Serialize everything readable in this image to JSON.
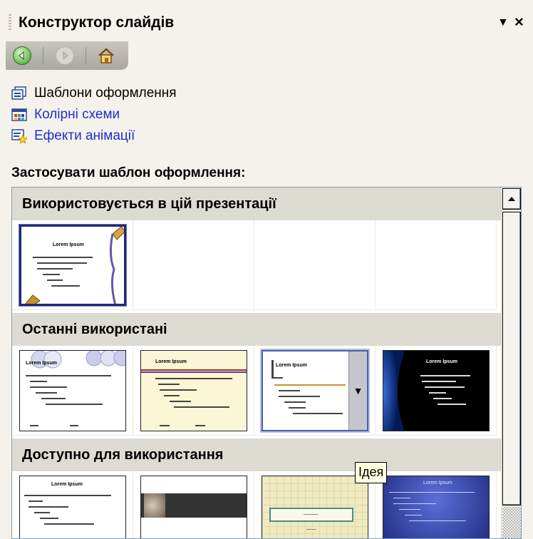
{
  "panel": {
    "title": "Конструктор слайдів",
    "menu_icon": "dropdown-arrow-icon",
    "close_label": "×"
  },
  "nav": {
    "back_icon": "back-arrow-icon",
    "forward_icon": "forward-arrow-icon",
    "home_icon": "home-icon"
  },
  "links": [
    {
      "label": "Шаблони оформлення",
      "icon": "design-templates-icon",
      "state": "current"
    },
    {
      "label": "Колірні схеми",
      "icon": "color-schemes-icon",
      "state": "link"
    },
    {
      "label": "Ефекти анімації",
      "icon": "animation-effects-icon",
      "state": "link"
    }
  ],
  "section_label": "Застосувати шаблон оформлення:",
  "groups": [
    {
      "label": "Використовується в цій презентації"
    },
    {
      "label": "Останні використані"
    },
    {
      "label": "Доступно для використання"
    }
  ],
  "thumb_text": {
    "lorem": "Lorem Ipsum"
  },
  "tooltip": "Ідея",
  "colors": {
    "link": "#1c2fd3",
    "selected_border": "#1d2a78",
    "group_header_bg": "#dedbd2",
    "panel_bg": "#f4f2ea"
  }
}
